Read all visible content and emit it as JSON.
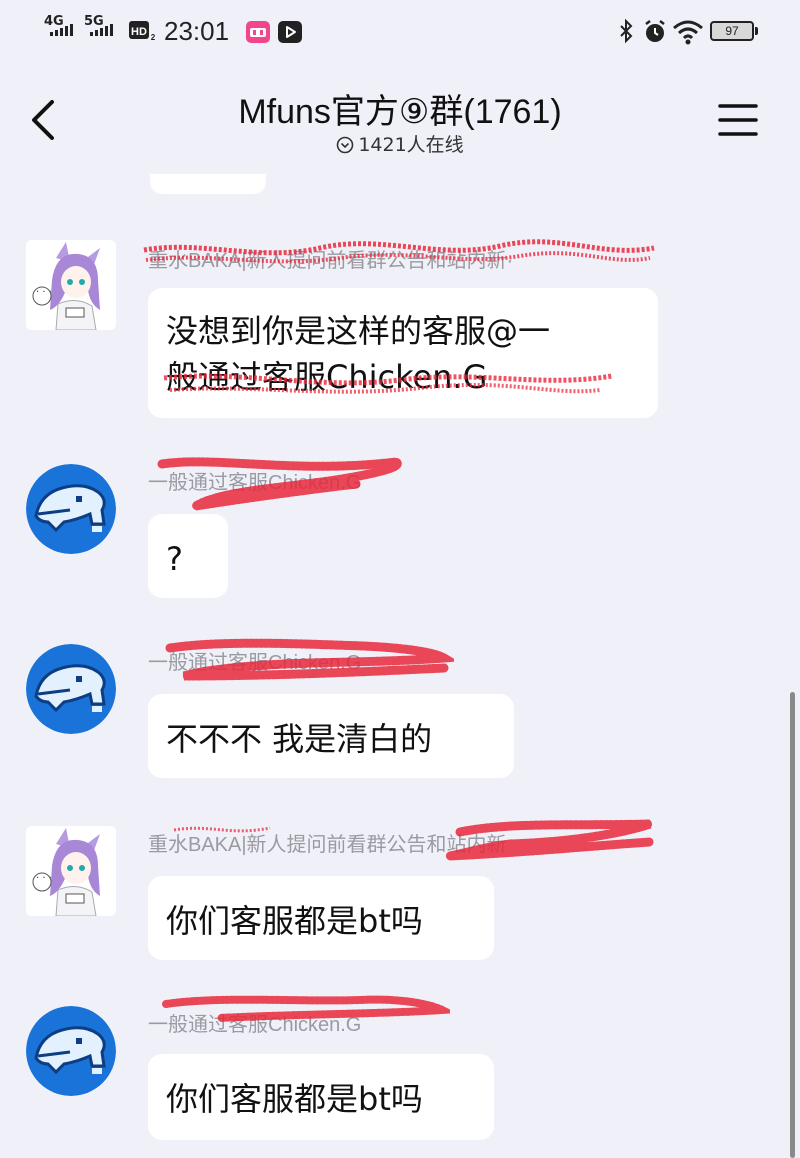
{
  "status_bar": {
    "signal1_label": "4G",
    "signal2_label": "5G",
    "hd_label": "HD",
    "time": "23:01",
    "battery": "97"
  },
  "header": {
    "title": "Mfuns官方⑨群(1761)",
    "online": "1421人在线"
  },
  "messages": [
    {
      "sender": "重水BAKA|新人提问前看群公告和站内新·",
      "text_line1": "没想到你是这样的客服@一",
      "text_line2": "般通过客服Chicken.G",
      "avatar": "anime-girl-avatar"
    },
    {
      "sender": "一般通过客服Chicken.G",
      "text": "?",
      "avatar": "pixel-dolphin-avatar"
    },
    {
      "sender": "一般通过客服Chicken.G",
      "text": "不不不 我是清白的",
      "avatar": "pixel-dolphin-avatar"
    },
    {
      "sender": "重水BAKA|新人提问前看群公告和站内新",
      "text": "你们客服都是bt吗",
      "avatar": "anime-girl-avatar"
    },
    {
      "sender": "一般通过客服Chicken.G",
      "text": "你们客服都是bt吗",
      "avatar": "pixel-dolphin-avatar"
    }
  ],
  "colors": {
    "background": "#f0f1f8",
    "bubble": "#ffffff",
    "redaction": "#e8283c",
    "avatar_blue": "#1a73d9"
  }
}
